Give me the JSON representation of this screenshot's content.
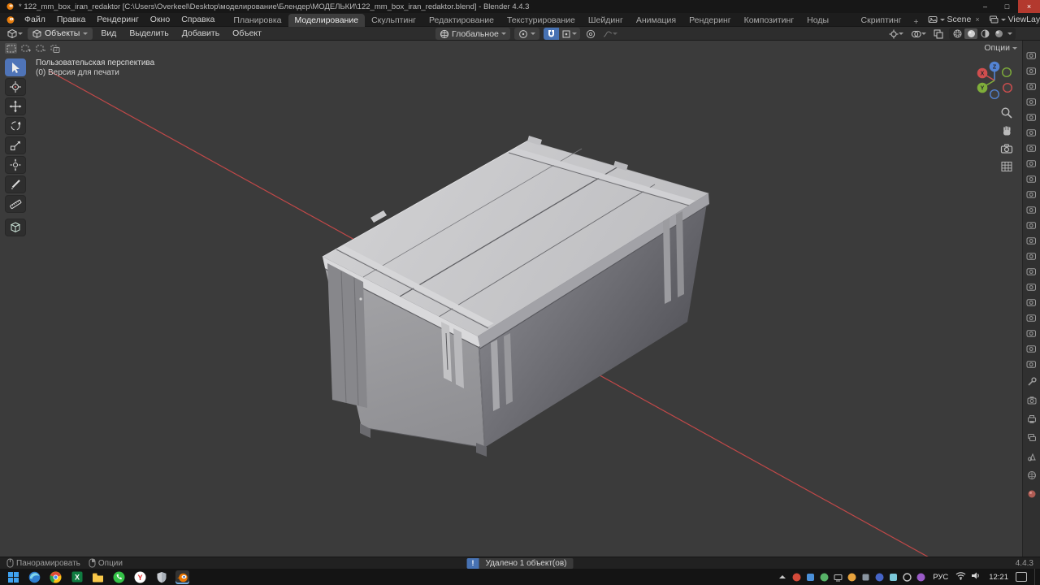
{
  "colors": {
    "accent_blue": "#4772b3",
    "axis_red": "#c04848",
    "viewport_bg": "#3b3b3b",
    "header_bg": "#1d1d1d"
  },
  "icons": {
    "close_x": "×",
    "status_alert": "!",
    "excel_letter": "X",
    "yandex_letter": "Y"
  },
  "title_bar": {
    "title": "* 122_mm_box_iran_redaktor [C:\\Users\\Overkeel\\Desktop\\моделирование\\Блендер\\МОДЕЛЬКИ\\122_mm_box_iran_redaktor.blend] - Blender 4.4.3",
    "minimize": "–",
    "maximize": "□",
    "close": "×"
  },
  "menu_bar": {
    "menus": [
      "Файл",
      "Правка",
      "Рендеринг",
      "Окно",
      "Справка"
    ],
    "workspaces": [
      "Планировка",
      "Моделирование",
      "Скульптинг",
      "Редактирование UV",
      "Текстурирование",
      "Шейдинг",
      "Анимация",
      "Рендеринг",
      "Композитинг",
      "Ноды геометрии",
      "Скриптинг"
    ],
    "add_workspace": "+",
    "active_workspace": "Моделирование",
    "scene_label": "Scene",
    "view_layer_label": "ViewLayer"
  },
  "tool_header": {
    "mode_label": "Объекты",
    "menus": [
      "Вид",
      "Выделить",
      "Добавить",
      "Объект"
    ],
    "orientation_label": "Глобальное"
  },
  "viewport": {
    "perspective_label": "Пользовательская перспектива",
    "view_label": "(0) Версия для печати",
    "options_label": "Опции",
    "gizmo_x": "X",
    "gizmo_y": "Y",
    "gizmo_z": "Z"
  },
  "right_strip": {
    "object_icon_count": 21
  },
  "status_bar": {
    "pan_hint": "Панорамировать",
    "options_hint": "Опции",
    "message": "Удалено 1 объект(ов)",
    "version": "4.4.3"
  },
  "taskbar": {
    "language": "РУС",
    "time": "12:21"
  }
}
